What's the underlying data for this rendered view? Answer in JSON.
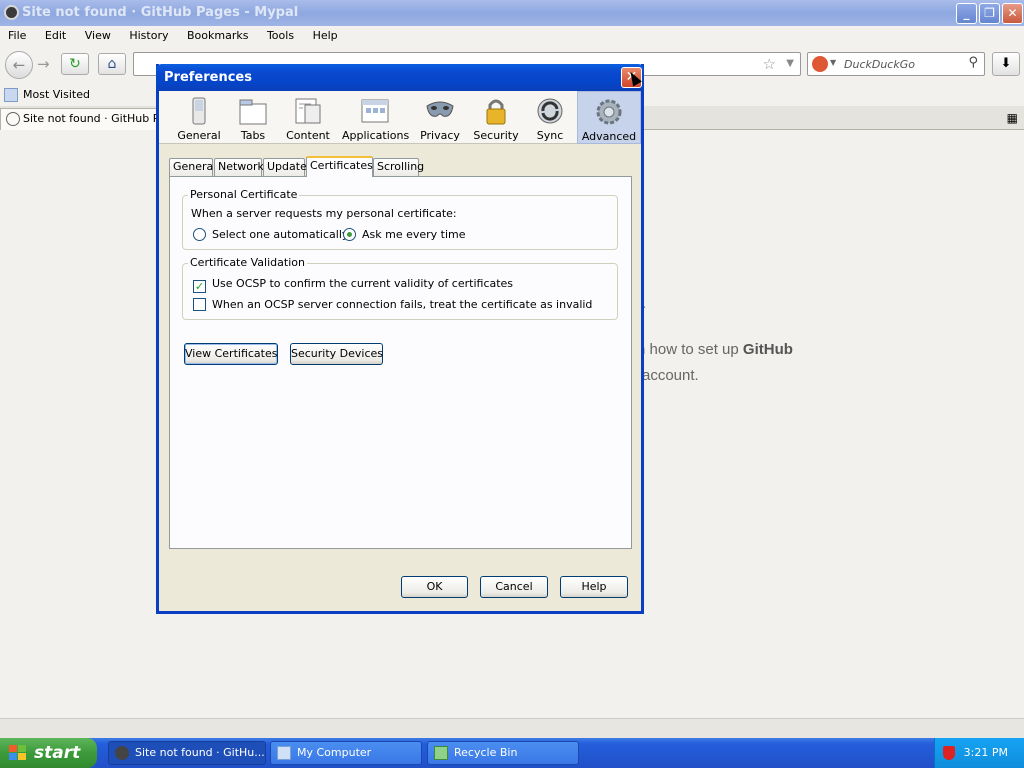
{
  "window": {
    "title": "Site not found · GitHub Pages - Mypal",
    "controls": [
      "_",
      "❐",
      "✕"
    ]
  },
  "menubar": [
    "File",
    "Edit",
    "View",
    "History",
    "Bookmarks",
    "Tools",
    "Help"
  ],
  "navbar": {
    "search_placeholder": "DuckDuckGo"
  },
  "bookmarks": {
    "most_visited": "Most Visited"
  },
  "tabstrip": {
    "active_tab": "Site not found · GitHub Pages"
  },
  "page": {
    "line1_prefix": "rn how to set up ",
    "line1_bold": "GitHub",
    "line2": " account.",
    "period": "."
  },
  "dialog": {
    "title": "Preferences",
    "close_label": "✕",
    "panes": [
      "General",
      "Tabs",
      "Content",
      "Applications",
      "Privacy",
      "Security",
      "Sync",
      "Advanced"
    ],
    "selected_pane": "Advanced",
    "subtabs": [
      "General",
      "Network",
      "Update",
      "Certificates",
      "Scrolling"
    ],
    "selected_subtab": "Certificates",
    "personal_cert": {
      "legend": "Personal Certificate",
      "prompt": "When a server requests my personal certificate:",
      "options": [
        "Select one automatically",
        "Ask me every time"
      ],
      "selected": "Ask me every time"
    },
    "cert_validation": {
      "legend": "Certificate Validation",
      "ocsp_label": "Use OCSP to confirm the current validity of certificates",
      "ocsp_checked": true,
      "fail_label": "When an OCSP server connection fails, treat the certificate as invalid",
      "fail_checked": false
    },
    "buttons": {
      "view_certs": "View Certificates",
      "security_devices": "Security Devices",
      "ok": "OK",
      "cancel": "Cancel",
      "help": "Help"
    }
  },
  "taskbar": {
    "start": "start",
    "items": [
      "Site not found · GitHu...",
      "My Computer",
      "Recycle Bin"
    ],
    "clock": "3:21 PM"
  },
  "colors": {
    "dialog_title": "#0a49d0",
    "taskbar": "#245edb",
    "start_green": "#3c9a3a",
    "selected_pane": "#c6d3ea"
  }
}
